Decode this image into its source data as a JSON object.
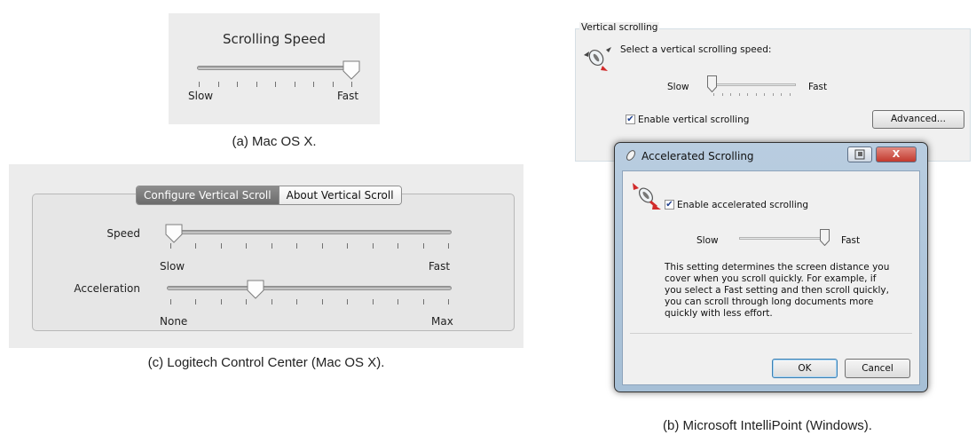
{
  "panel_a": {
    "title": "Scrolling Speed",
    "slow_label": "Slow",
    "fast_label": "Fast",
    "slider_value": 1.0,
    "tick_count": 9,
    "caption": "(a) Mac OS X."
  },
  "panel_c": {
    "tabs": [
      "Configure Vertical Scroll",
      "About Vertical Scroll"
    ],
    "speed_label": "Speed",
    "speed_min_label": "Slow",
    "speed_max_label": "Fast",
    "speed_value": 0.0,
    "acceleration_label": "Acceleration",
    "accel_min_label": "None",
    "accel_max_label": "Max",
    "acceleration_value": 0.3,
    "tick_count": 12,
    "caption": "(c) Logitech Control Center (Mac OS X)."
  },
  "panel_b": {
    "group_label": "Vertical scrolling",
    "prompt": "Select a vertical scrolling speed:",
    "slow_label": "Slow",
    "fast_label": "Fast",
    "speed_value": 0.0,
    "enable_label": "Enable vertical scrolling",
    "enable_checked": true,
    "advanced_button": "Advanced...",
    "dialog": {
      "title": "Accelerated Scrolling",
      "enable_label": "Enable accelerated scrolling",
      "enable_checked": true,
      "slow_label": "Slow",
      "fast_label": "Fast",
      "accel_value": 1.0,
      "description": "This setting determines the screen distance you cover when you scroll quickly.  For example, if you select a Fast setting and then scroll quickly, you can scroll through long documents more quickly with less effort.",
      "ok_button": "OK",
      "cancel_button": "Cancel",
      "close_glyph": "X"
    },
    "caption": "(b) Microsoft IntelliPoint (Windows)."
  },
  "colors": {
    "mac_panel_bg": "#ececec",
    "win_panel_bg": "#f0f0f0",
    "dialog_frame": "#a6bfd6",
    "close_button": "#c9463d"
  }
}
